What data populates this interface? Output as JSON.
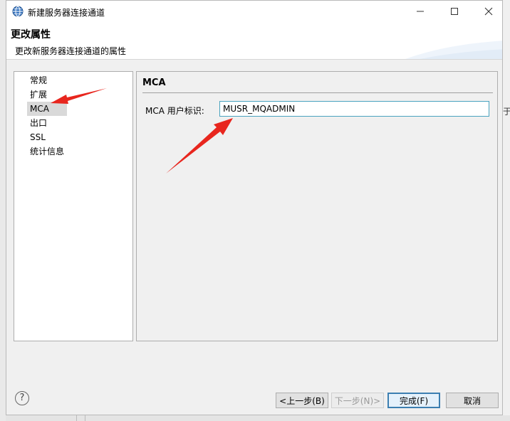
{
  "window": {
    "title": "新建服务器连接通道",
    "minimize_icon": "minimize-icon",
    "maximize_icon": "maximize-icon",
    "close_icon": "close-icon"
  },
  "banner": {
    "title": "更改属性",
    "description": "更改新服务器连接通道的属性"
  },
  "nav": {
    "items": [
      {
        "label": "常规"
      },
      {
        "label": "扩展"
      },
      {
        "label": "MCA",
        "selected": true
      },
      {
        "label": "出口"
      },
      {
        "label": "SSL"
      },
      {
        "label": "统计信息"
      }
    ]
  },
  "content": {
    "section_title": "MCA",
    "field_label": "MCA 用户标识:",
    "field_value": "MUSR_MQADMIN"
  },
  "buttons": {
    "help": "?",
    "back": "<上一步(B)",
    "next": "下一步(N)>",
    "finish": "完成(F)",
    "cancel": "取消"
  },
  "background": {
    "fragment": "于"
  },
  "colors": {
    "annotation_arrow": "#e8261e",
    "input_border": "#4aa3bf",
    "default_button_border": "#3c7fb1"
  }
}
